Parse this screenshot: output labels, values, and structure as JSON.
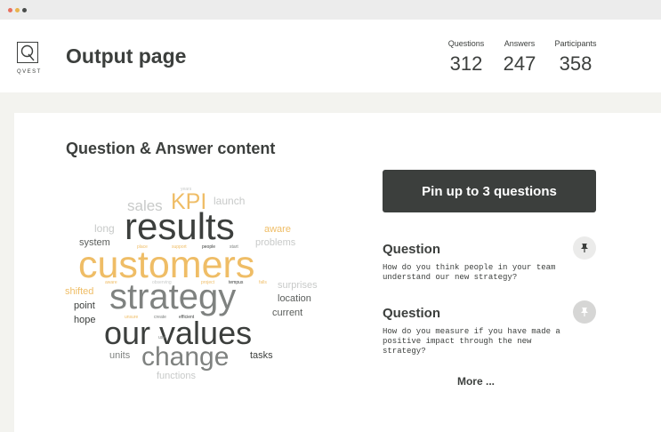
{
  "window": {
    "controls": [
      "close",
      "minimize",
      "maximize"
    ]
  },
  "logo": {
    "text": "QVEST"
  },
  "header": {
    "title": "Output page"
  },
  "stats": [
    {
      "label": "Questions",
      "value": "312"
    },
    {
      "label": "Answers",
      "value": "247"
    },
    {
      "label": "Participants",
      "value": "358"
    }
  ],
  "content": {
    "section_title": "Question & Answer content"
  },
  "word_cloud": {
    "words": {
      "sales": "sales",
      "launch": "launch",
      "kpi": "KPI",
      "long": "long",
      "results": "results",
      "aware": "aware",
      "system": "system",
      "place": "place",
      "support": "support",
      "people": "people",
      "start": "start",
      "problems": "problems",
      "customers": "customers",
      "shifted": "shifted",
      "aware2": "aware",
      "observing": "observing",
      "project": "project",
      "tempus": "tempus",
      "falls": "falls",
      "surprises": "surprises",
      "strategy": "strategy",
      "location": "location",
      "point": "point",
      "current": "current",
      "hope": "hope",
      "unsure": "unsure",
      "create": "create",
      "efficient": "efficient",
      "our_values": "our values",
      "use": "use",
      "units": "units",
      "change": "change",
      "tasks": "tasks",
      "functions": "functions",
      "tiny_top": "years"
    }
  },
  "pin_panel": {
    "button_label": "Pin up to 3 questions",
    "questions": [
      {
        "label": "Question",
        "text": "How do you think people in your team understand our new strategy?",
        "pin_icon": "pin-icon"
      },
      {
        "label": "Question",
        "text": "How do you measure if you have made a positive impact through the new strategy?",
        "pin_icon": "pin-icon"
      }
    ],
    "more_label": "More ..."
  },
  "colors": {
    "dark": "#3c3f3d",
    "accent": "#efbd66",
    "grey": "#7f8280",
    "light_grey": "#c8cac9",
    "background": "#f3f3ef"
  }
}
